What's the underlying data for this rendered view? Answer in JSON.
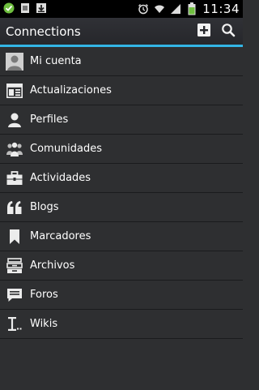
{
  "status_bar": {
    "time": "11:34",
    "left_icons": [
      "check-circle-icon",
      "sim-card-icon",
      "download-icon"
    ],
    "right_icons": [
      "alarm-icon",
      "wifi-icon",
      "signal-icon",
      "battery-icon"
    ]
  },
  "action_bar": {
    "title": "Connections",
    "add_icon": "add-icon",
    "search_icon": "search-icon",
    "accent_color": "#33b5e5"
  },
  "menu": {
    "items": [
      {
        "label": "Mi cuenta",
        "icon": "avatar-icon"
      },
      {
        "label": "Actualizaciones",
        "icon": "updates-icon"
      },
      {
        "label": "Perfiles",
        "icon": "person-icon"
      },
      {
        "label": "Comunidades",
        "icon": "communities-icon"
      },
      {
        "label": "Actividades",
        "icon": "briefcase-icon"
      },
      {
        "label": "Blogs",
        "icon": "quote-icon"
      },
      {
        "label": "Marcadores",
        "icon": "bookmark-icon"
      },
      {
        "label": "Archivos",
        "icon": "files-icon"
      },
      {
        "label": "Foros",
        "icon": "forum-icon"
      },
      {
        "label": "Wikis",
        "icon": "wiki-icon"
      }
    ]
  }
}
